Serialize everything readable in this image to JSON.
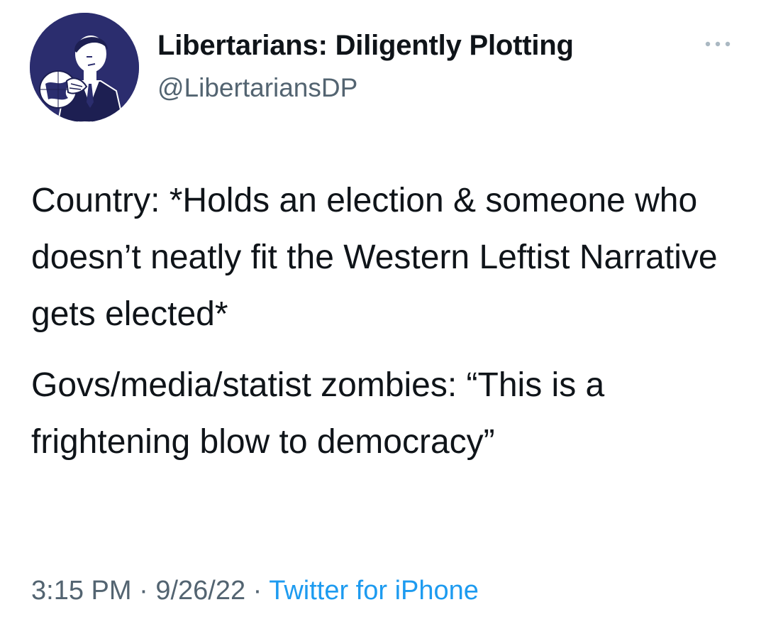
{
  "author": {
    "display_name": "Libertarians: Diligently Plotting",
    "handle": "@LibertariansDP",
    "avatar_icon": "vintage-man-holding-globe",
    "avatar_bg": "#2b2d6e"
  },
  "more_icon": "ellipsis-icon",
  "tweet": {
    "paragraph1": "Country: *Holds an election & someone who doesn’t neatly fit the Western Leftist Narrative gets elected*",
    "paragraph2": "Govs/media/statist zombies: “This is a frightening blow to democracy”"
  },
  "meta": {
    "time": "3:15 PM",
    "separator": " · ",
    "date": "9/26/22",
    "source": "Twitter for iPhone"
  },
  "colors": {
    "text_primary": "#0f1419",
    "text_secondary": "#536471",
    "link": "#1d9bf0"
  }
}
